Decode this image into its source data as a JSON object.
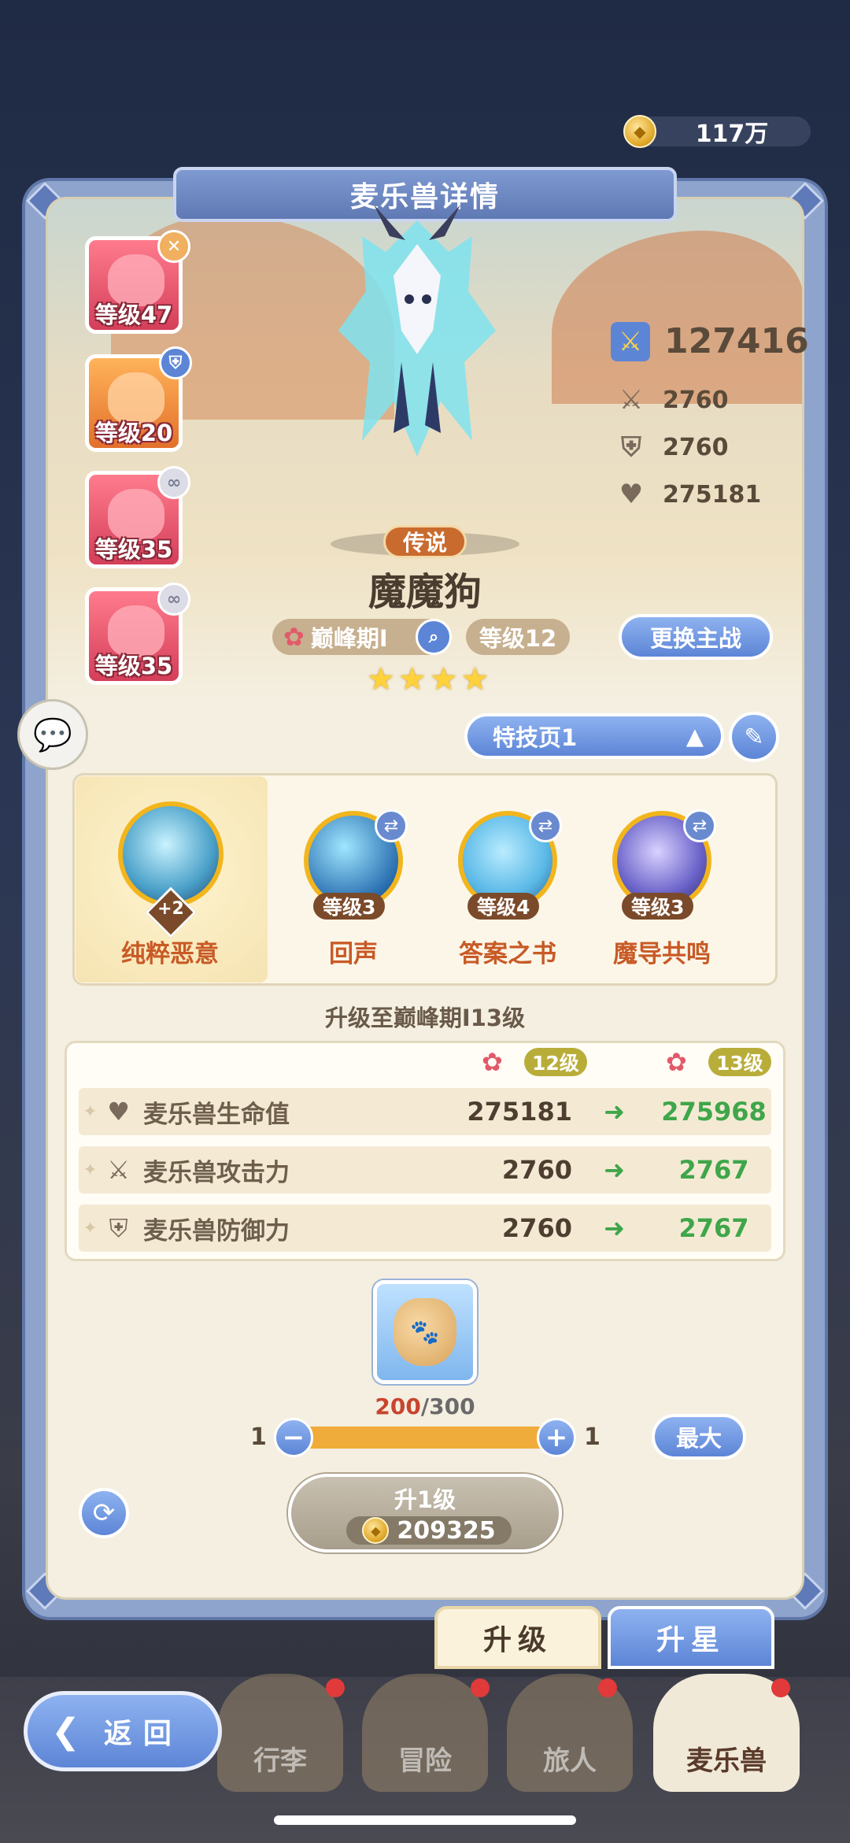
{
  "currency": {
    "amount": "117万",
    "icon": "gold-coin-icon"
  },
  "panel": {
    "title": "麦乐兽详情"
  },
  "roster": [
    {
      "level": "等级47",
      "badge": "✕",
      "badge_icon": "close-icon"
    },
    {
      "level": "等级20",
      "badge": "⛨",
      "badge_icon": "shield-icon"
    },
    {
      "level": "等级35",
      "badge": "∞",
      "badge_icon": "link-icon"
    },
    {
      "level": "等级35",
      "badge": "∞",
      "badge_icon": "link-icon"
    }
  ],
  "hero": {
    "rarity": "传说",
    "name": "魔魔狗",
    "stage": "巅峰期I",
    "level": "等级12",
    "stars": 4,
    "swap_label": "更换主战"
  },
  "stats": {
    "power": "127416",
    "attack": "2760",
    "defense": "2760",
    "hp": "275181"
  },
  "skill_page": {
    "label": "特技页1"
  },
  "skills": [
    {
      "name": "纯粹恶意",
      "badge": "+2",
      "level": "",
      "selected": true
    },
    {
      "name": "回声",
      "level": "等级3"
    },
    {
      "name": "答案之书",
      "level": "等级4"
    },
    {
      "name": "魔导共鸣",
      "level": "等级3"
    }
  ],
  "upgrade": {
    "title": "升级至巅峰期I13级",
    "from_level": "12级",
    "to_level": "13级",
    "rows": [
      {
        "label": "麦乐兽生命值",
        "icon": "heart-icon",
        "from": "275181",
        "to": "275968"
      },
      {
        "label": "麦乐兽攻击力",
        "icon": "swords-icon",
        "from": "2760",
        "to": "2767"
      },
      {
        "label": "麦乐兽防御力",
        "icon": "shield-icon",
        "from": "2760",
        "to": "2767"
      }
    ],
    "material": {
      "have": "200",
      "need": "/300",
      "icon": "food-sack-icon"
    },
    "slider": {
      "min_label": "1",
      "max_label": "1",
      "fill": 1.0
    },
    "max_label": "最大",
    "button_label": "升1级",
    "cost": "209325"
  },
  "tabs": {
    "upgrade": "升级",
    "star": "升星"
  },
  "nav": {
    "back": "返回",
    "items": [
      "行李",
      "冒险",
      "旅人",
      "麦乐兽"
    ]
  }
}
